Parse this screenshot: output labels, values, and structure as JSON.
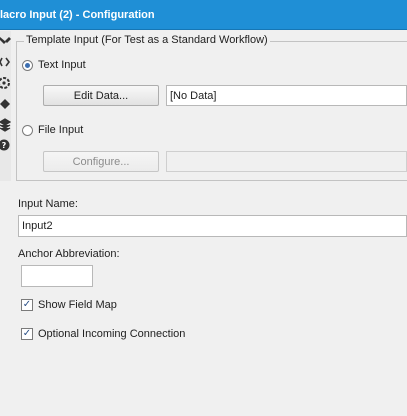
{
  "window": {
    "title": "lacro Input (2) - Configuration"
  },
  "toolstrip": {
    "icons": [
      "wrench-icon",
      "code-icon",
      "gear-icon",
      "tag-icon",
      "stack-icon",
      "help-icon"
    ]
  },
  "template_input": {
    "legend": "Template Input (For Test as a Standard Workflow)",
    "text_input_label": "Text Input",
    "edit_data_label": "Edit Data...",
    "data_value": "[No Data]",
    "file_input_label": "File Input",
    "configure_label": "Configure...",
    "file_value": ""
  },
  "input_name": {
    "label": "Input Name:",
    "value": "Input2"
  },
  "anchor": {
    "label": "Anchor Abbreviation:",
    "value": ""
  },
  "options": {
    "show_field_map_label": "Show Field Map",
    "optional_incoming_label": "Optional Incoming Connection"
  }
}
